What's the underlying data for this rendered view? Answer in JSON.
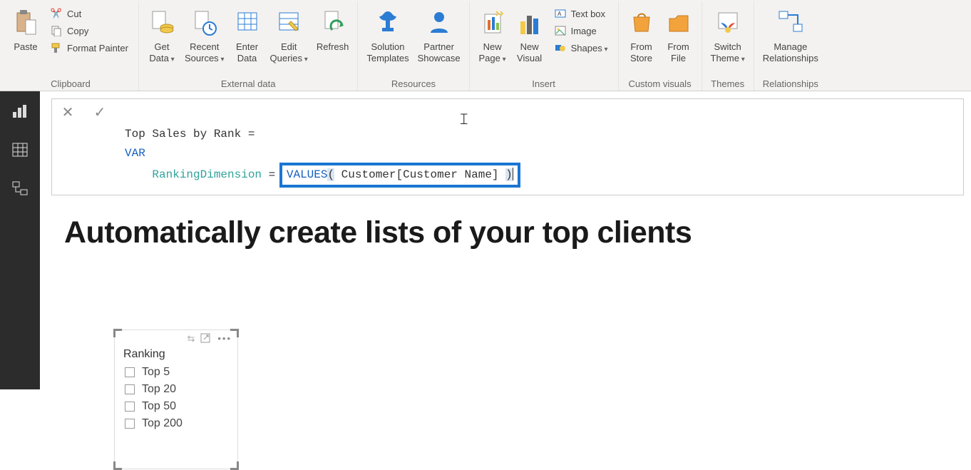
{
  "ribbon": {
    "clipboard": {
      "label": "Clipboard",
      "paste": "Paste",
      "cut": "Cut",
      "copy": "Copy",
      "format_painter": "Format Painter"
    },
    "external": {
      "label": "External data",
      "get_data": "Get\nData",
      "recent_sources": "Recent\nSources",
      "enter_data": "Enter\nData",
      "edit_queries": "Edit\nQueries",
      "refresh": "Refresh"
    },
    "resources": {
      "label": "Resources",
      "solution_templates": "Solution\nTemplates",
      "partner_showcase": "Partner\nShowcase"
    },
    "insert": {
      "label": "Insert",
      "new_page": "New\nPage",
      "new_visual": "New\nVisual",
      "text_box": "Text box",
      "image": "Image",
      "shapes": "Shapes"
    },
    "custom_visuals": {
      "label": "Custom visuals",
      "from_store": "From\nStore",
      "from_file": "From\nFile"
    },
    "themes": {
      "label": "Themes",
      "switch_theme": "Switch\nTheme"
    },
    "relationships": {
      "label": "Relationships",
      "manage": "Manage\nRelationships"
    }
  },
  "formula": {
    "line1": "Top Sales by Rank =",
    "var": "VAR",
    "name": "RankingDimension",
    "eq": "=",
    "func": "VALUES",
    "open": "(",
    "arg": " Customer[Customer Name] ",
    "close": ")"
  },
  "canvas": {
    "title": "Automatically create lists of your top clients"
  },
  "slicer": {
    "title": "Ranking",
    "items": [
      "Top 5",
      "Top 20",
      "Top 50",
      "Top 200"
    ]
  }
}
